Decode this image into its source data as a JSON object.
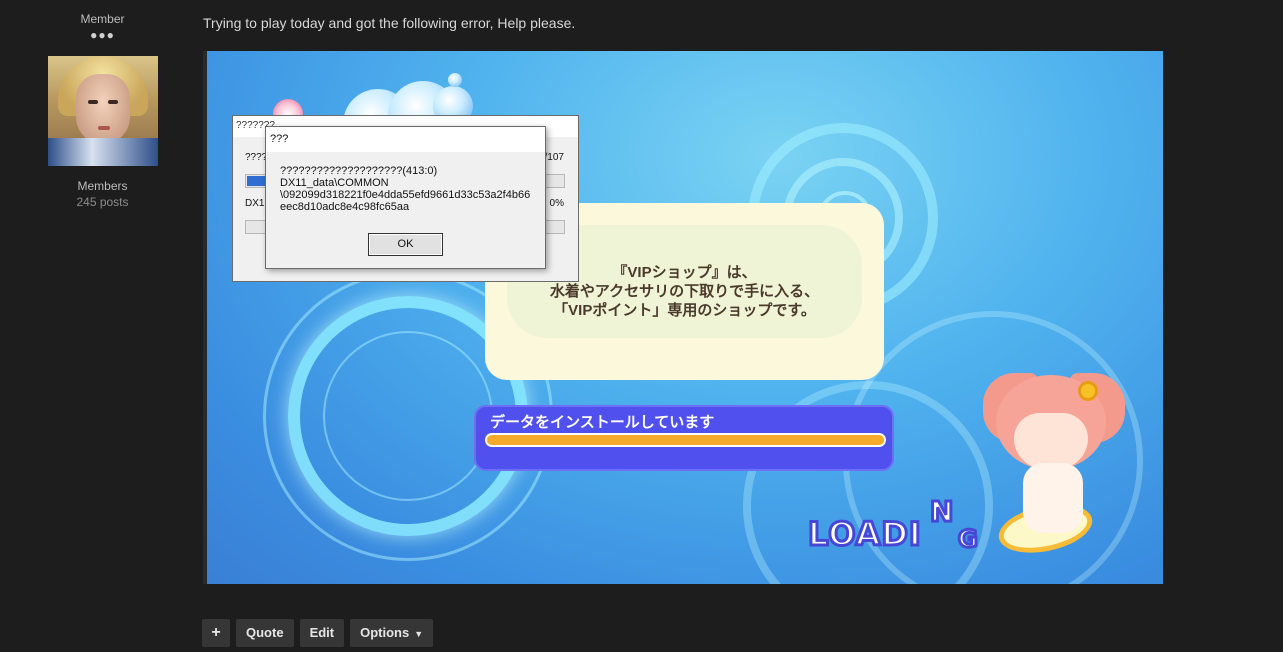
{
  "author": {
    "rank": "Member",
    "rank_pips": "●●●",
    "group": "Members",
    "posts": "245 posts"
  },
  "post": {
    "text": "Trying to play today and got the following error, Help please."
  },
  "screenshot": {
    "tip_lines": [
      "『VIPショップ』は、",
      "水着やアクセサリの下取りで手に入る、",
      "「VIPポイント」専用のショップです。"
    ],
    "progress_label": "データをインストールしています",
    "progress_fraction": 0.99,
    "loading_text": "LOADI",
    "loading_n": "N",
    "loading_g": "G"
  },
  "dialog_back": {
    "title": "???????",
    "row1_left": "????",
    "row1_right": "/107",
    "progress_fraction": 0.06,
    "row2_left": "DX1",
    "row2_right": "0%"
  },
  "dialog_error": {
    "title": "???",
    "message_line1": "????????????????????(413:0)",
    "message_line2": "DX11_data\\COMMON",
    "message_line3": "\\092099d318221f0e4dda55efd9661d33c53a2f4b66",
    "message_line4": "eec8d10adc8e4c98fc65aa",
    "ok_label": "OK"
  },
  "actions": {
    "plus_label": "+",
    "quote_label": "Quote",
    "edit_label": "Edit",
    "options_label": "Options"
  },
  "colors": {
    "page_bg": "#1d1d1d",
    "progress_bg": "#5050ee",
    "progress_fill": "#f5aa2a",
    "tip_bg": "#fbf8dc"
  }
}
